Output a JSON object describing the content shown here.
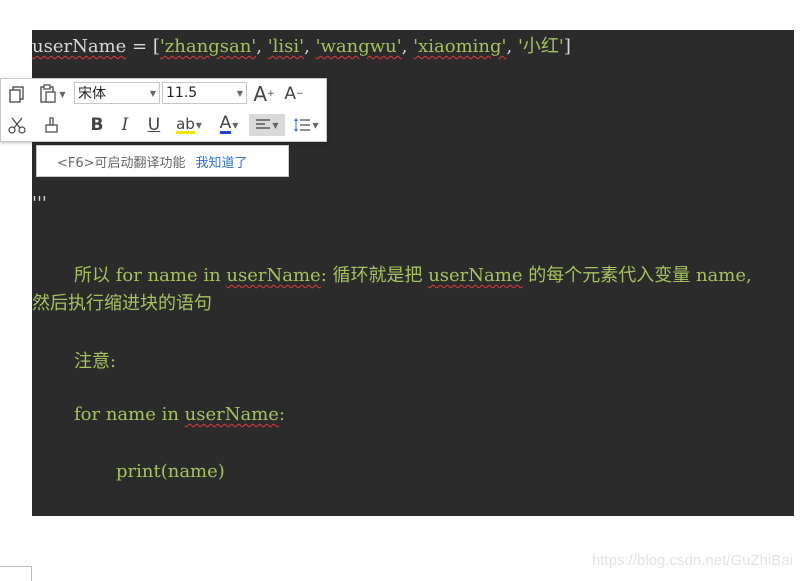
{
  "code": {
    "line1": {
      "var": "userName",
      "op": " = [",
      "items": [
        "'zhangsan'",
        ", ",
        "'lisi'",
        ", ",
        "'wangwu'",
        ", ",
        "'xiaoming'",
        ", ",
        "'小红'"
      ],
      "close": "]"
    },
    "line_quotes": "'''",
    "para": {
      "part1": "所以 for name in ",
      "var": "userName",
      "part2": ": 循环就是把 ",
      "var2": "userName",
      "part3": " 的每个元素代入变量 name,",
      "line2": "然后执行缩进块的语句"
    },
    "note": "注意:",
    "for_line": {
      "a": "for name in ",
      "var": "userName",
      "b": ":"
    },
    "print_line": "print(name)"
  },
  "toolbar": {
    "font_name": "宋体",
    "font_size": "11.5",
    "icons": [
      "copy-icon",
      "paste-icon",
      "cut-icon",
      "format-painter-icon",
      "grow-font-icon",
      "shrink-font-icon",
      "bold-icon",
      "italic-icon",
      "underline-icon",
      "highlight-icon",
      "font-color-icon",
      "align-icon",
      "line-spacing-icon"
    ],
    "grow_label": "A",
    "shrink_label": "A",
    "bold_label": "B",
    "italic_label": "I",
    "underline_label": "U",
    "highlight_label": "ab",
    "color_label": "A"
  },
  "tip": {
    "text": "<F6>可启动翻译功能",
    "link": "我知道了"
  },
  "watermark": "https://blog.csdn.net/GuZhiBai",
  "colors": {
    "code_bg": "#2b2b2b",
    "code_text": "#a5c25c",
    "link": "#2f6fdb"
  }
}
